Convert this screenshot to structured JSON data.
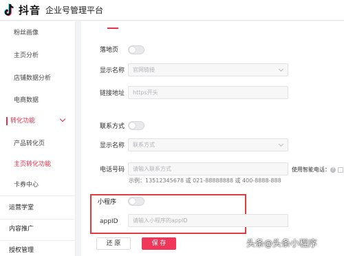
{
  "header": {
    "logo_text": "抖音",
    "subtitle": "企业号管理平台"
  },
  "sidebar": {
    "items": [
      {
        "label": "粉丝画像"
      },
      {
        "label": "主页分析"
      },
      {
        "label": "店铺数据分析"
      },
      {
        "label": "电商数据"
      },
      {
        "label": "转化功能"
      },
      {
        "label": "产品转化页"
      },
      {
        "label": "主页转化功能"
      },
      {
        "label": "卡券中心"
      },
      {
        "label": "运营学堂"
      },
      {
        "label": "内容推广"
      },
      {
        "label": "授权管理"
      }
    ]
  },
  "form": {
    "landing": {
      "section_label": "落地页",
      "display_name_label": "显示名称",
      "display_name_placeholder": "官网链接",
      "link_label": "链接地址",
      "link_placeholder": "https开头"
    },
    "contact": {
      "section_label": "联系方式",
      "display_name_label": "显示名称",
      "display_name_placeholder": "联系方式",
      "phone_label": "电话号码",
      "phone_placeholder": "请输入联系方式",
      "smart_phone_label": "使用智能电话：",
      "help_glyph": "?",
      "example_text": "示例：13512345678 或 021-88888888 或 400-8888-888"
    },
    "mini_program": {
      "section_label": "小程序",
      "appid_label": "appID",
      "appid_placeholder": "请输入小程序的appID"
    },
    "buttons": {
      "reset_label": "还 原",
      "save_label": "保 存"
    }
  },
  "watermark": {
    "prefix": "头条",
    "at": "@",
    "name": "头条小程序"
  },
  "colors": {
    "accent": "#e8304a",
    "save_button": "#f0375a",
    "highlight_border": "#e23b3b"
  }
}
